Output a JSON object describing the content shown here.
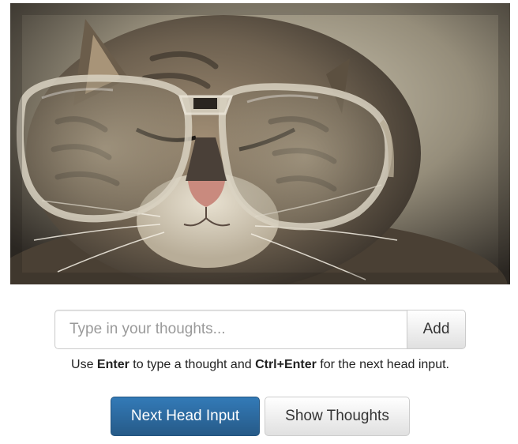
{
  "photo": {
    "subject": "cat wearing oversized glasses"
  },
  "thought_input": {
    "placeholder": "Type in your thoughts...",
    "value": ""
  },
  "add_button": {
    "label": "Add"
  },
  "help": {
    "prefix": "Use ",
    "key_enter": "Enter",
    "middle": " to type a thought and ",
    "key_ctrl_enter": "Ctrl+Enter",
    "suffix": " for the next head input."
  },
  "buttons": {
    "next_head_input": "Next Head Input",
    "show_thoughts": "Show Thoughts"
  },
  "colors": {
    "primary": "#337ab7",
    "primary_dark": "#265a88"
  }
}
